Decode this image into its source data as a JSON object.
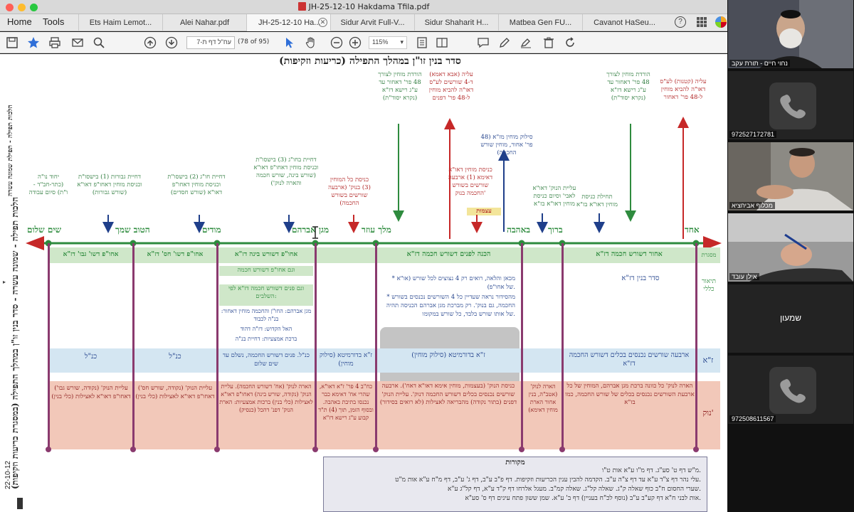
{
  "window": {
    "title": "JH-25-12-10 Hakdama Tfila.pdf",
    "traffic_colors": [
      "#ff5f57",
      "#febc2e",
      "#28c840"
    ]
  },
  "menu": {
    "home": "Home",
    "tools": "Tools"
  },
  "tabs": [
    {
      "label": "Ets Haim Lemot..."
    },
    {
      "label": "Alei Nahar.pdf"
    },
    {
      "label": "JH-25-12-10 Ha..."
    },
    {
      "label": "Sidur Arvit Full-V..."
    },
    {
      "label": "Sidur Shaharit H..."
    },
    {
      "label": "Matbea Gen FU..."
    },
    {
      "label": "Cavanot HaSeu..."
    }
  ],
  "toolbar": {
    "page_label": "עח\"ל דף ת-7",
    "page_count": "(78 of 95)",
    "zoom": "115%"
  },
  "document": {
    "heading": "סדר בנין זו\"ן במהלך התפילה (כריעות וזקיפות)",
    "left_margin_title": "הלכות תפילה - שמונה עשרה - סדר בנין זו\"ן במהלך התפילה (במסגרת כריעות וזקיפות)",
    "top_left_margin": "הלכות תפילה - תפילת שמונה עשרה",
    "date": "22-10-12",
    "top_notes": [
      {
        "text": "הורדת מוחין לצורך 48 פר' דאחור עד ע\"ג רישא דז\"א (נקרא יסוד\"ת)",
        "color": "green"
      },
      {
        "text": "עליה (אבא דאמא) ד-4 שורשים לע\"ס דאו\"ה להביא מוחין ל-48 פר' דפנים",
        "color": "red"
      },
      {
        "text": "הורדת מוחין לצורך 48 פר' דאחור עד ע\"ג רישא דז\"א (נקרא יסוד\"ת)",
        "color": "green"
      },
      {
        "text": "עליה (קטנות) לע\"ס דאו\"ה להביא מוחין ל-48 פר' דאחור",
        "color": "red"
      }
    ],
    "mid_notes": [
      {
        "text": "יחוד נו\"ה (כתר-חב\"ד -ו\"ת) סיום עבודה",
        "color": "blue"
      },
      {
        "text": "דחיית גבורות (1) בישסו\"ת וכניסת מוחין דאחו\"פ דאו\"א (שורש גבורות)",
        "color": "blue"
      },
      {
        "text": "דחיית חו\"ג (2) בישסו\"ת וכניסת מוחין דאחו\"פ דאו\"א (שורש חסדים)",
        "color": "blue"
      },
      {
        "text": "דחיית בחו\"ג (3) בישסו\"ת וכניסת מוחין דאחו\"פ דאו\"א (שורש בינה, שורש חכמה והארה לנוק')",
        "color": "blue"
      },
      {
        "text": "כניסת כל המוחין (3) בנוק' (ארבעה שורשים בשורש החכמה)",
        "color": "red"
      },
      {
        "text": "כניסת מוחין דאו\"א דאימא (1) ארבעה שורשים בשורש החכמה בנוק'",
        "color": "red"
      },
      {
        "text": "עצמות",
        "color": "red"
      },
      {
        "text": "סילוק מוחין מז\"א (48 פר' אחור, מוחין שורש החכמה)",
        "color": "blue"
      },
      {
        "text": "עליית הנוק' דאו\"א לאבי' וסיום כניסת מוחין דאו\"א בז\"א",
        "color": "green"
      },
      {
        "text": "תחילת כניסת מוחין דאו\"א בז\"א",
        "color": "green"
      }
    ],
    "timeline_labels": [
      "שים שלום",
      "הטוב שמך",
      "מודים",
      "מגן אברהם",
      "מלך עוזר",
      "באהבה",
      "ברוך",
      "אחד"
    ],
    "band_green": {
      "label_right": "מסגרת",
      "cells": [
        "אחו\"פ דשו' גבו' דז\"א",
        "אחו\"פ דשו' חס' דז\"א",
        "אחו\"פ דשורש בינה דז\"א",
        "הכנה לפנים דשורש חכמה דז\"א",
        "אחור דשורש חכמה דז\"א"
      ]
    },
    "general_row": {
      "label": "תיאור כללי",
      "right_cell": "סדר בנין דז\"א",
      "col3_lines": [
        "וגם אחו\"פ דשורש חכמה",
        "וגם פנים דשורש חכמה דז\"א לפי השלבים:",
        "מגן אברהם: החו\"ן והחכמה מוחין דאחור: בנ\"ה לכבוד",
        "האל הקדוש: דז\"ה דהוד",
        "ברכת אמצעיות: דחיית בנ\"ה"
      ],
      "grey_lines": [
        "* מכאן והלאה, רואים רק 4 נצוצים לכל שורש (או\"א של אחו\"פ).",
        "* מהסידור נראה שעדיין כל 4 השורשים נכנסים בשורש החכמה, גם בנוק'. רק מברכת מגן אברהם הכניסה תהיה של אותו שורש בלבד, כל שורש במקומו."
      ]
    },
    "za_row": {
      "label": "ז\"א",
      "cells": [
        "כנ\"ל",
        "כנ\"ל",
        "כנ\"ל. פנים דשורש החכמה, נשלם עד שים שלום",
        "ז\"א בדורמיטא (סילוק מוחין)",
        "ז\"א בדורמיטא (סילוק מוחין)",
        "ארבעה שורשים נכנסים בכלים דשורש החכמה דז\"א"
      ]
    },
    "nuk_row": {
      "label": "נוק'",
      "cells": [
        "עליית הנוק' (נקודה, שורש גבו') דאחו\"פ דאו\"א לאצילות (כלי בנין)",
        "עליית הנוק' (נקודה, שורש חס') דאחו\"פ דאו\"א לאצילות (כלי בנין)",
        "הארה לנוק' (אח' דשורש החכמה). עליית הנוק' (נקודה, שורש בינה) דאחו\"פ דאו\"א לאצילות (כלי בנין) ברכות אמצעיות: הארת הנוק' דפנ' דהכל (כנסיק)",
        "כח\"ב 4 פר' ז\"א דאו\"א, שהרי אח' דאימא כבר נכנסו בתיבת באהבה. ובסוף הזמן, תוך (4) ת\"ד קבוע ע\"ג רישא דז\"א",
        "כניסת הנוק' (בעצמות, מוחין אימא דאו\"א דאח'). ארבעה שורשים נכנסים בכלים דשורש החכמה דנוק'. עליית הנוק' דפנים (בתור נקודה) מהבריאה לאצילות (לא רואים בסידור)",
        "הארה לנוק' (אטב\"ה, בנין אחור הארת מוחין דאימא)",
        "הארה לנוק' כל כוונה ברכת מגן אברהם, המוחין של כל ארבעת השורשים נכנסים בכלים של שורש החכמה, כמו בז\"א"
      ]
    },
    "sources": {
      "title": "מקורות",
      "lines": [
        "מ\"ש דף ט' סע\"ג. דף מ\"ו ע\"א אות ט\"ו.",
        "עלי נהר דף צ\"ד ע\"א עד דף צ\"ה ע\"ב. הקדמה להבין ענין הכריעות וזקיפות. דף פ\"ב ע\"ב, דף ג' ע\"ב, דף מ\"ח ע\"א אות מ\"ט.",
        "שערי החסום ח\"ב כוף שאלה ק\"ג. שאלה קל\"ג. שאלה קמ\"ב. מעגל אלרחו דף ק\"ד ע\"א, דף קל\"ג ע\"א.",
        "אות לבני ח\"א דף קע\"ב ע\"ב (נוסף לכ\"ח בעניין) דף ב' ע\"א. שמן ששון פתח עינים דף ס' סע\"א."
      ]
    }
  },
  "participants": [
    {
      "name": "נחוי חיים - תורת עקב",
      "type": "video"
    },
    {
      "name": "972527172781",
      "type": "phone"
    },
    {
      "name": "מכלוף אביחציא",
      "type": "video"
    },
    {
      "name": "אילן עובד",
      "type": "video"
    },
    {
      "name": "שמעון",
      "type": "name"
    },
    {
      "name": "972508611567",
      "type": "phone"
    }
  ],
  "colors": {
    "accent_blue": "#2f6fd8",
    "timeline_green": "#2e8b3e",
    "arrow_red": "#c62828",
    "vline": "#8a3a6e"
  }
}
